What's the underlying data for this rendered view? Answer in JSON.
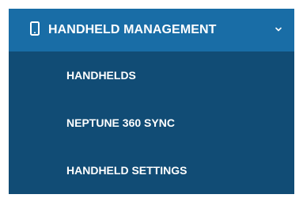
{
  "menu": {
    "header": {
      "label": "HANDHELD MANAGEMENT",
      "icon": "handheld-device-icon",
      "expand_icon": "chevron-down-icon",
      "expanded": true
    },
    "items": [
      {
        "label": "HANDHELDS"
      },
      {
        "label": "NEPTUNE 360 SYNC"
      },
      {
        "label": "HANDHELD SETTINGS"
      }
    ],
    "colors": {
      "header_background": "#196da6",
      "submenu_background": "#114c75",
      "text": "#ffffff"
    }
  }
}
